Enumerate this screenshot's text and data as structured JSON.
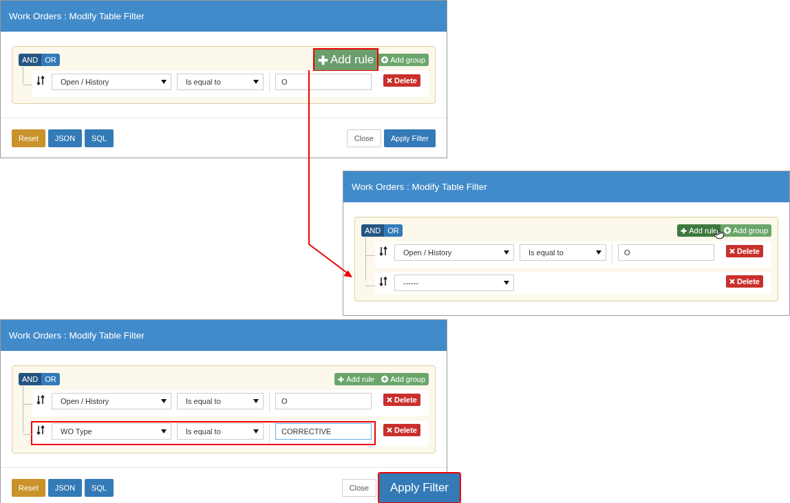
{
  "panels": [
    {
      "title": "Work Orders : Modify Table Filter",
      "conjunctions": [
        {
          "label": "AND",
          "selected": true
        },
        {
          "label": "OR",
          "selected": false
        }
      ],
      "add_rule": {
        "label": "Add rule",
        "kind": "zoomed"
      },
      "add_group": "Add group",
      "rules": [
        {
          "field": "Open / History",
          "operator": "Is equal to",
          "value": "O",
          "highlighted": false,
          "delete": "Delete"
        }
      ],
      "footer": {
        "left": [
          {
            "label": "Reset",
            "kind": "warning"
          },
          {
            "label": "JSON",
            "kind": "primary"
          },
          {
            "label": "SQL",
            "kind": "primary"
          }
        ],
        "close": "Close",
        "apply": {
          "label": "Apply Filter",
          "kind": "normal"
        }
      }
    },
    {
      "title": "Work Orders : Modify Table Filter",
      "conjunctions": [
        {
          "label": "AND",
          "selected": true
        },
        {
          "label": "OR",
          "selected": false
        }
      ],
      "add_rule": {
        "label": "Add rule",
        "kind": "hover"
      },
      "add_group": "Add group",
      "rules": [
        {
          "field": "Open / History",
          "operator": "Is equal to",
          "value": "O",
          "highlighted": false,
          "delete": "Delete"
        },
        {
          "field": "------",
          "highlighted": false,
          "delete": "Delete"
        }
      ]
    },
    {
      "title": "Work Orders : Modify Table Filter",
      "conjunctions": [
        {
          "label": "AND",
          "selected": true
        },
        {
          "label": "OR",
          "selected": false
        }
      ],
      "add_rule": {
        "label": "Add rule",
        "kind": "normal"
      },
      "add_group": "Add group",
      "rules": [
        {
          "field": "Open / History",
          "operator": "Is equal to",
          "value": "O",
          "highlighted": false,
          "delete": "Delete"
        },
        {
          "field": "WO Type",
          "operator": "Is equal to",
          "value": "CORRECTIVE",
          "highlighted": true,
          "delete": "Delete"
        }
      ],
      "footer": {
        "left": [
          {
            "label": "Reset",
            "kind": "warning"
          },
          {
            "label": "JSON",
            "kind": "primary"
          },
          {
            "label": "SQL",
            "kind": "primary"
          }
        ],
        "close": "Close",
        "apply": {
          "label": "Apply Filter",
          "kind": "zoomed"
        }
      }
    }
  ]
}
